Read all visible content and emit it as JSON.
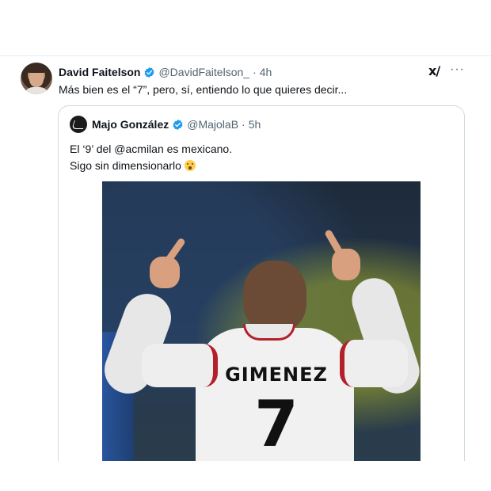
{
  "tweet": {
    "author_name": "David Faitelson",
    "author_handle": "@DavidFaitelson_",
    "separator": "·",
    "time": "4h",
    "text": "Más bien es el “7”, pero, sí, entiendo lo que quieres decir...",
    "actions": {
      "grok_icon": "grok-icon",
      "more_icon": "more-icon",
      "more_glyph": "···"
    }
  },
  "quote": {
    "author_name": "Majo González",
    "author_handle": "@MajolaB",
    "separator": "·",
    "time": "5h",
    "text_lines": [
      "El ‘9’ del @acmilan es mexicano.",
      "Sigo sin dimensionarlo"
    ],
    "emoji": "astonished-face",
    "photo": {
      "jersey_name": "GIMENEZ",
      "jersey_number": "7"
    }
  },
  "colors": {
    "verified_blue": "#1d9bf0",
    "secondary_text": "#536471",
    "border": "#cfd9de",
    "milan_red": "#b3202a"
  }
}
